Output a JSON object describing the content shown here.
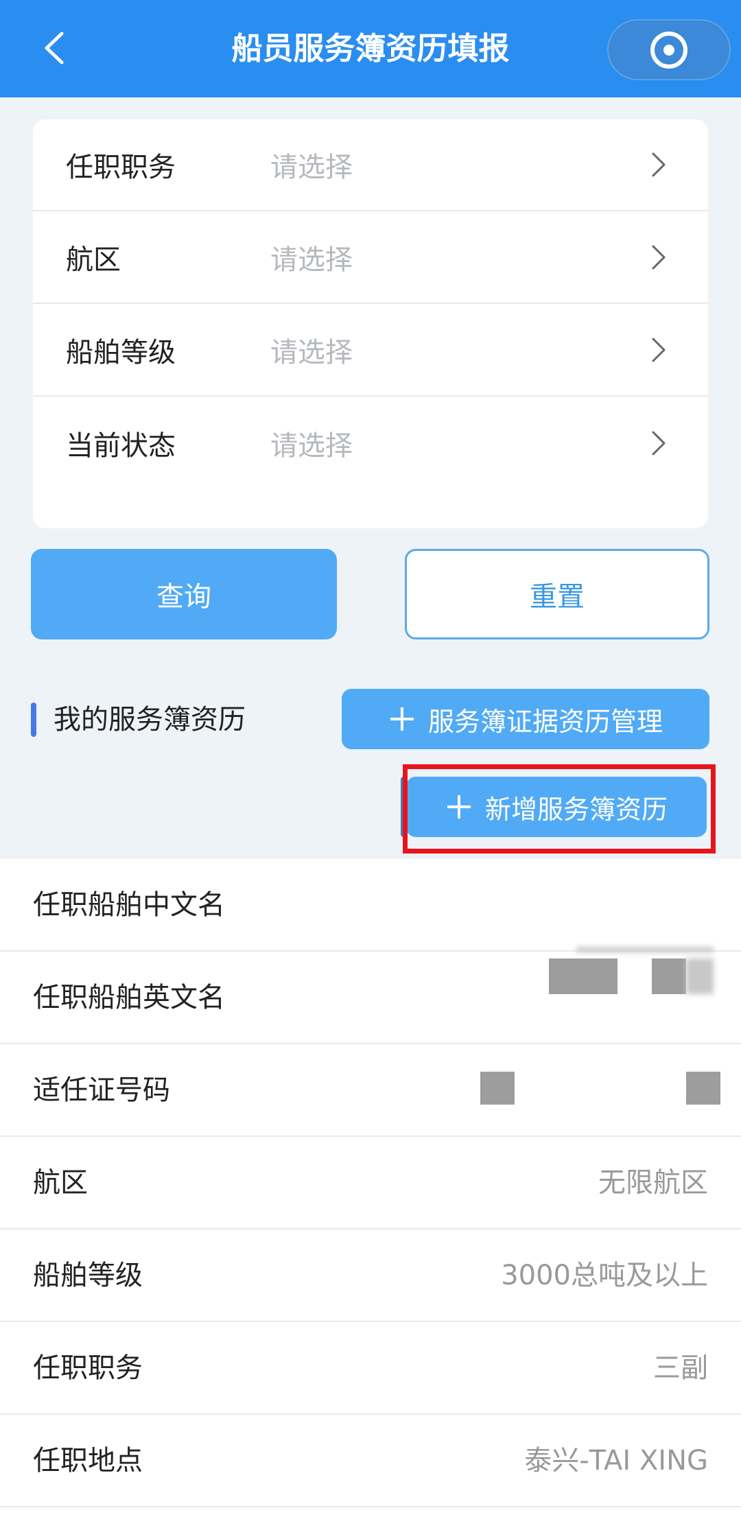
{
  "header": {
    "title": "船员服务簿资历填报",
    "back_icon": "chevron-left-icon",
    "capsule_icon": "record-icon",
    "color": "#2a8df0"
  },
  "filters": [
    {
      "label": "任职职务",
      "placeholder": "请选择"
    },
    {
      "label": "航区",
      "placeholder": "请选择"
    },
    {
      "label": "船舶等级",
      "placeholder": "请选择"
    },
    {
      "label": "当前状态",
      "placeholder": "请选择"
    }
  ],
  "actions": {
    "query_label": "查询",
    "reset_label": "重置"
  },
  "section": {
    "title": "我的服务簿资历",
    "manage_label": "服务簿证据资历管理",
    "add_label": "新增服务簿资历",
    "accent": "#51aaf5",
    "highlight_color": "#e8141c"
  },
  "detail": [
    {
      "label": "任职船舶中文名",
      "value": ""
    },
    {
      "label": "任职船舶英文名",
      "value": ""
    },
    {
      "label": "适任证号码",
      "value": ""
    },
    {
      "label": "航区",
      "value": "无限航区"
    },
    {
      "label": "船舶等级",
      "value": "3000总吨及以上"
    },
    {
      "label": "任职职务",
      "value": "三副"
    },
    {
      "label": "任职地点",
      "value": "泰兴-TAI XING"
    }
  ]
}
